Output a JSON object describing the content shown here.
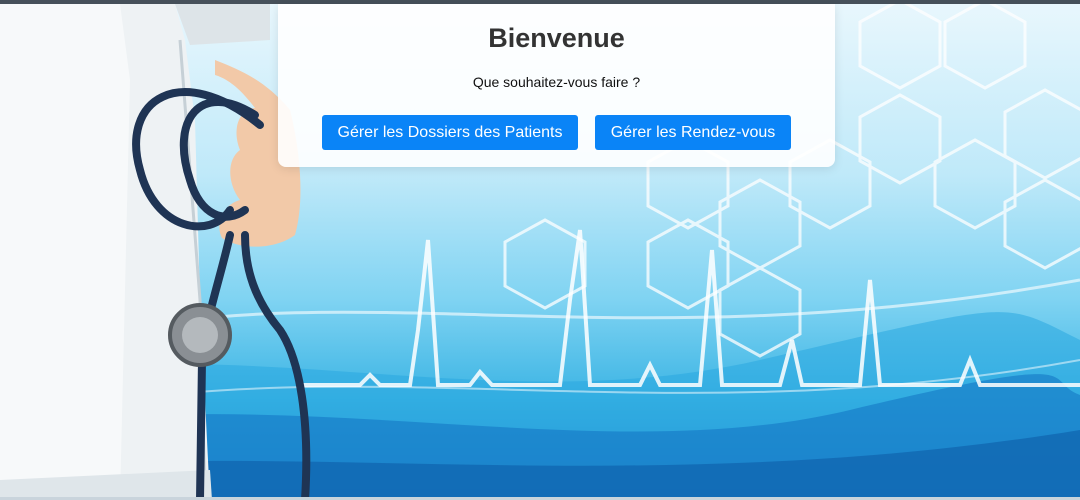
{
  "welcome": {
    "title": "Bienvenue",
    "subtitle": "Que souhaitez-vous faire ?"
  },
  "actions": {
    "patients_label": "Gérer les Dossiers des Patients",
    "appointments_label": "Gérer les Rendez-vous"
  },
  "theme": {
    "accent": "#0a84f7",
    "title_color": "#333333",
    "background_top": "#e9f7fd",
    "background_bottom": "#1a7fc9"
  },
  "background_icons": [
    "doctor-coat-image",
    "stethoscope-icon",
    "hexagon-pattern",
    "heartbeat-line"
  ]
}
